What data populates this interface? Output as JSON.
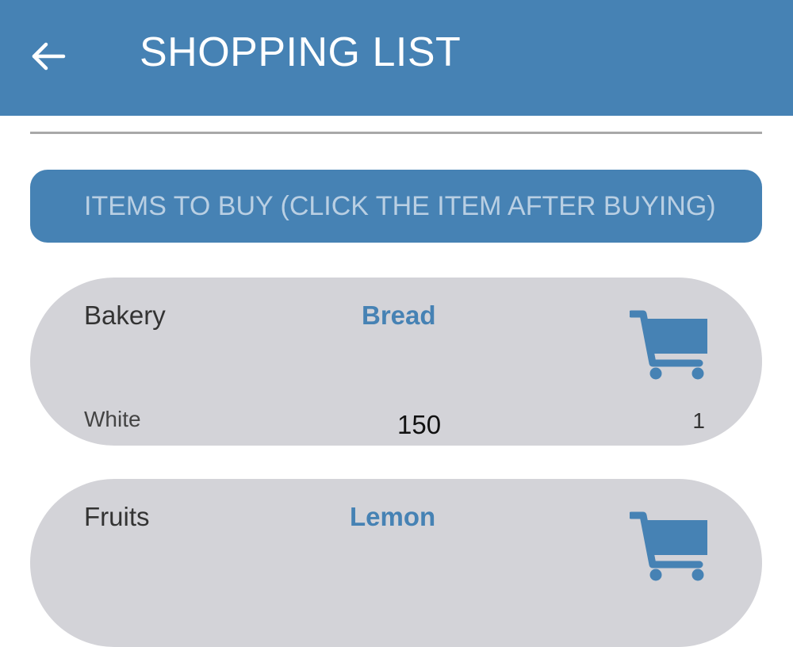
{
  "header": {
    "title": "SHOPPING LIST",
    "back_icon": "arrow-left-icon",
    "background_color": "#4682b4"
  },
  "section": {
    "label": "ITEMS TO BUY (CLICK THE ITEM AFTER BUYING)"
  },
  "items": [
    {
      "category": "Bakery",
      "name": "Bread",
      "variant": "White",
      "price": "150",
      "quantity": "1",
      "icon": "shopping-cart-icon"
    },
    {
      "category": "Fruits",
      "name": "Lemon",
      "icon": "shopping-cart-icon"
    }
  ],
  "colors": {
    "accent": "#4682b4",
    "card_background": "#d3d3d8"
  }
}
